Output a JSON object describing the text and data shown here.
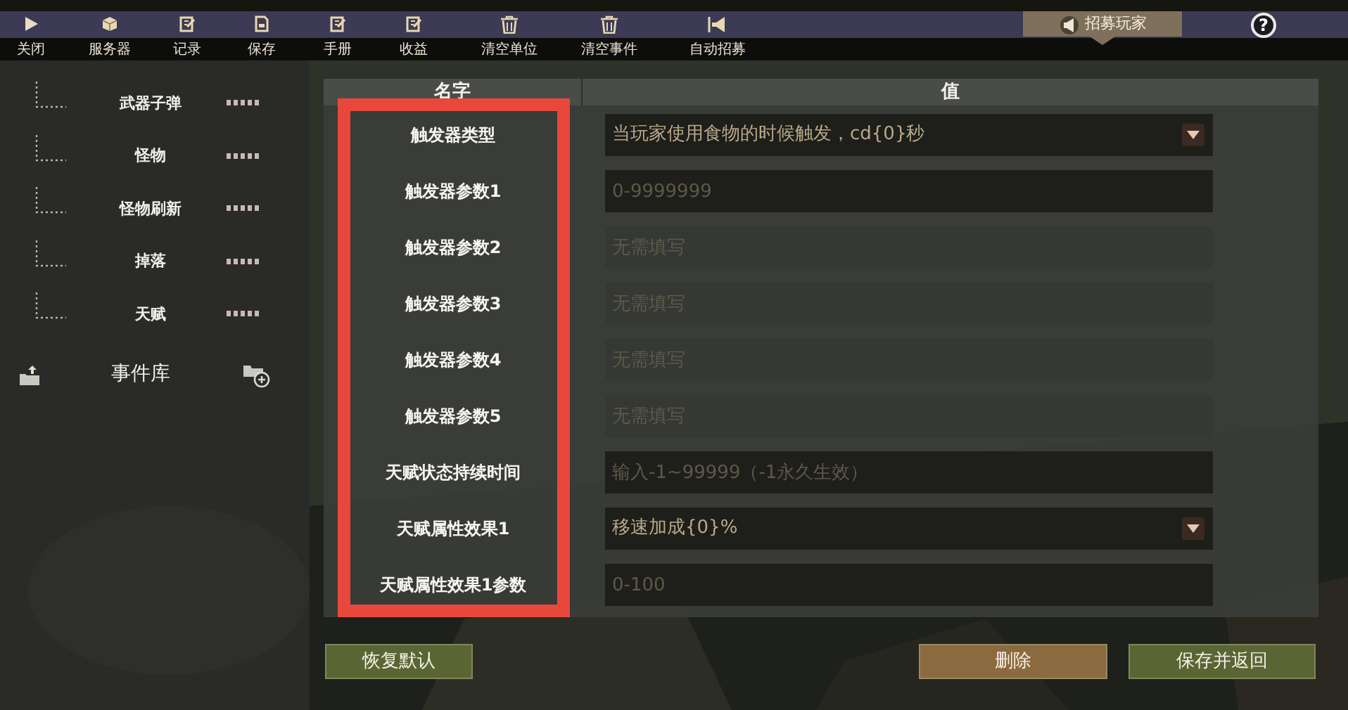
{
  "toolbar": [
    {
      "label": "关闭"
    },
    {
      "label": "服务器"
    },
    {
      "label": "记录"
    },
    {
      "label": "保存"
    },
    {
      "label": "手册"
    },
    {
      "label": "收益"
    },
    {
      "label": "清空单位"
    },
    {
      "label": "清空事件"
    },
    {
      "label": "自动招募"
    }
  ],
  "recruit_tab": {
    "label": "招募玩家"
  },
  "help": {
    "label": "?"
  },
  "sidebar": {
    "items": [
      {
        "label": "武器子弹"
      },
      {
        "label": "怪物"
      },
      {
        "label": "怪物刷新"
      },
      {
        "label": "掉落"
      },
      {
        "label": "天赋"
      }
    ],
    "library": {
      "label": "事件库"
    }
  },
  "table": {
    "columns": [
      "名字",
      "值"
    ],
    "rows": [
      {
        "name": "触发器类型",
        "kind": "select",
        "value": "当玩家使用食物的时候触发，cd{0}秒"
      },
      {
        "name": "触发器参数1",
        "kind": "input",
        "placeholder": "0-9999999",
        "disabled": false
      },
      {
        "name": "触发器参数2",
        "kind": "input",
        "placeholder": "无需填写",
        "disabled": true
      },
      {
        "name": "触发器参数3",
        "kind": "input",
        "placeholder": "无需填写",
        "disabled": true
      },
      {
        "name": "触发器参数4",
        "kind": "input",
        "placeholder": "无需填写",
        "disabled": true
      },
      {
        "name": "触发器参数5",
        "kind": "input",
        "placeholder": "无需填写",
        "disabled": true
      },
      {
        "name": "天赋状态持续时间",
        "kind": "input",
        "placeholder": "输入-1~99999（-1永久生效）",
        "disabled": false
      },
      {
        "name": "天赋属性效果1",
        "kind": "select",
        "value": "移速加成{0}%"
      },
      {
        "name": "天赋属性效果1参数",
        "kind": "input",
        "placeholder": "0-100",
        "disabled": false
      }
    ]
  },
  "buttons": {
    "reset": "恢复默认",
    "delete": "删除",
    "save": "保存并返回"
  }
}
